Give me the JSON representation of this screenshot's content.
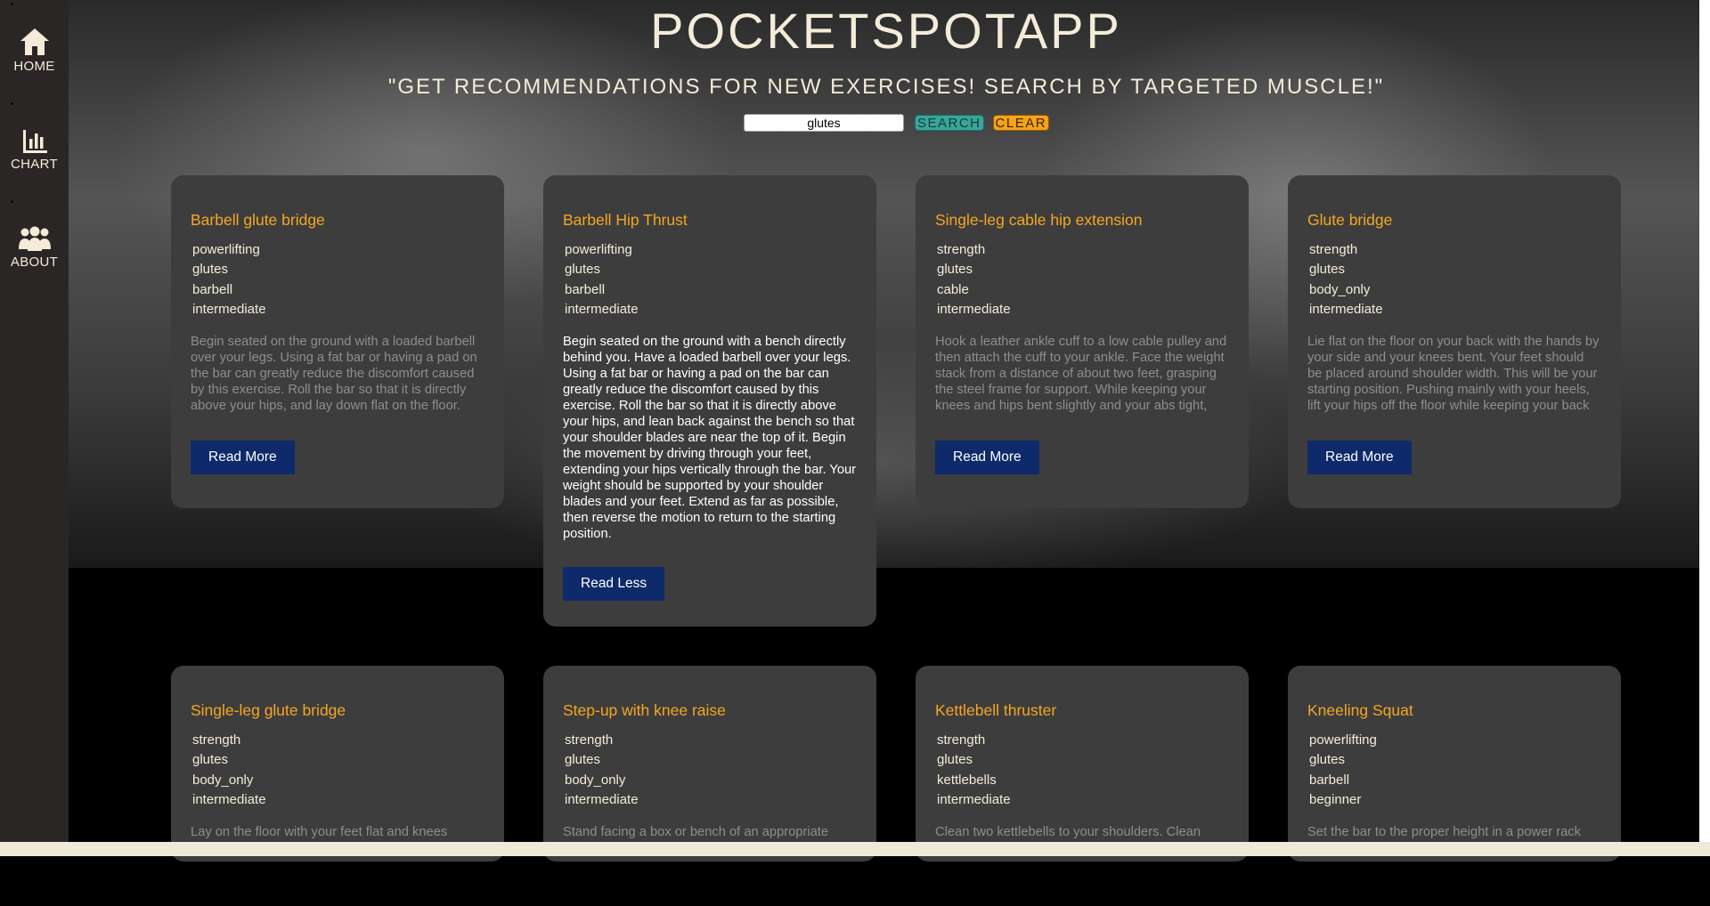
{
  "nav": {
    "home_label": "HOME",
    "chart_label": "CHART",
    "about_label": "ABOUT",
    "bullet": "•"
  },
  "header": {
    "title": "POCKETSPOTAPP",
    "tagline": "\"GET RECOMMENDATIONS FOR NEW EXERCISES! SEARCH BY TARGETED MUSCLE!\""
  },
  "search": {
    "value": "glutes",
    "search_label": "SEARCH",
    "clear_label": "CLEAR"
  },
  "cards": [
    {
      "title": "Barbell glute bridge",
      "tags": [
        "powerlifting",
        "glutes",
        "barbell",
        "intermediate"
      ],
      "description": "Begin seated on the ground with a loaded barbell over your legs. Using a fat bar or having a pad on the bar can greatly reduce the discomfort caused by this exercise. Roll the bar so that it is directly above your hips, and lay down flat on the floor. Begin the movement by",
      "button": "Read More"
    },
    {
      "title": "Barbell Hip Thrust",
      "tags": [
        "powerlifting",
        "glutes",
        "barbell",
        "intermediate"
      ],
      "description": "Begin seated on the ground with a bench directly behind you. Have a loaded barbell over your legs. Using a fat bar or having a pad on the bar can greatly reduce the discomfort caused by this exercise. Roll the bar so that it is directly above your hips, and lean back against the bench so that your shoulder blades are near the top of it. Begin the movement by driving through your feet, extending your hips vertically through the bar. Your weight should be supported by your shoulder blades and your feet. Extend as far as possible, then reverse the motion to return to the starting position.",
      "button": "Read Less"
    },
    {
      "title": "Single-leg cable hip extension",
      "tags": [
        "strength",
        "glutes",
        "cable",
        "intermediate"
      ],
      "description": "Hook a leather ankle cuff to a low cable pulley and then attach the cuff to your ankle. Face the weight stack from a distance of about two feet, grasping the steel frame for support. While keeping your knees and hips bent slightly and your abs tight, contract your glutes to slowly",
      "button": "Read More"
    },
    {
      "title": "Glute bridge",
      "tags": [
        "strength",
        "glutes",
        "body_only",
        "intermediate"
      ],
      "description": "Lie flat on the floor on your back with the hands by your side and your knees bent. Your feet should be placed around shoulder width. This will be your starting position. Pushing mainly with your heels, lift your hips off the floor while keeping your back straight. Breathe out as you",
      "button": "Read More"
    },
    {
      "title": "Single-leg glute bridge",
      "tags": [
        "strength",
        "glutes",
        "body_only",
        "intermediate"
      ],
      "description": "Lay on the floor with your feet flat and knees",
      "button": "Read More"
    },
    {
      "title": "Step-up with knee raise",
      "tags": [
        "strength",
        "glutes",
        "body_only",
        "intermediate"
      ],
      "description": "Stand facing a box or bench of an appropriate",
      "button": "Read More"
    },
    {
      "title": "Kettlebell thruster",
      "tags": [
        "strength",
        "glutes",
        "kettlebells",
        "intermediate"
      ],
      "description": "Clean two kettlebells to your shoulders. Clean",
      "button": "Read More"
    },
    {
      "title": "Kneeling Squat",
      "tags": [
        "powerlifting",
        "glutes",
        "barbell",
        "beginner"
      ],
      "description": "Set the bar to the proper height in a power rack",
      "button": "Read More"
    }
  ]
}
